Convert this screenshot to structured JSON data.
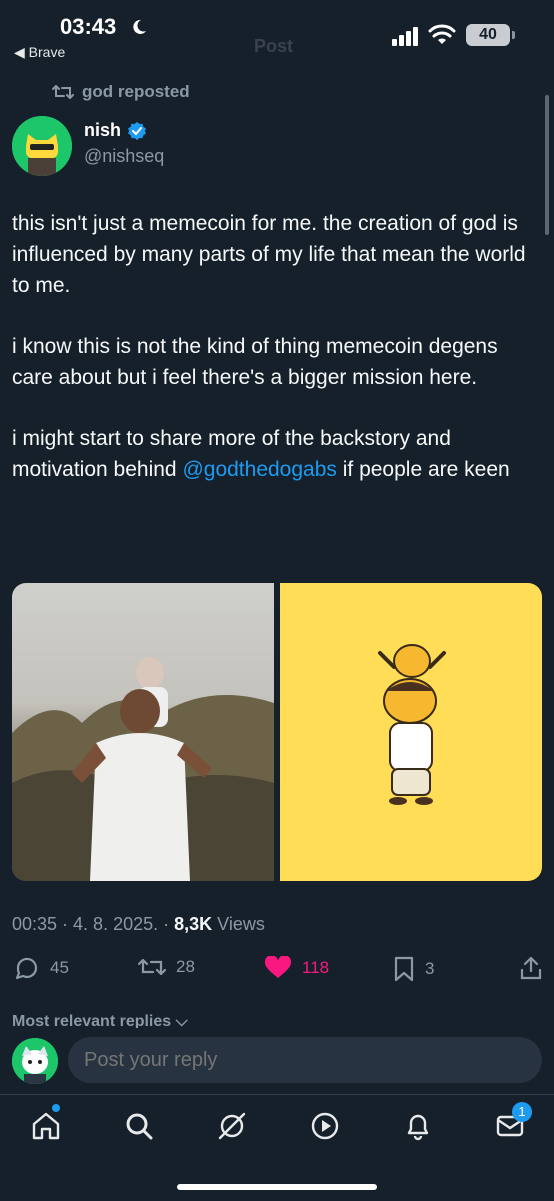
{
  "status_bar": {
    "time": "03:43",
    "back_label": "◀ Brave",
    "battery": "40",
    "ghost_title": "Post"
  },
  "repost": {
    "label": "god reposted"
  },
  "author": {
    "name": "nish",
    "handle": "@nishseq"
  },
  "tweet": {
    "p1": "this isn't just a memecoin for me. the creation of god is influenced by many parts of my life that mean the world to me.",
    "p2": "i know this is not the kind of thing memecoin degens care about but i feel there's a bigger mission here.",
    "p3_before": "i might start to share more of the backstory and motivation behind ",
    "p3_mention": "@godthedogabs",
    "p3_after": " if people are keen"
  },
  "meta": {
    "time": "00:35 · 4. 8. 2025. · ",
    "views_count": "8,3K",
    "views_label": " Views"
  },
  "actions": {
    "replies": "45",
    "reposts": "28",
    "likes": "118",
    "bookmarks": "3"
  },
  "replies_header": "Most relevant replies ⌵",
  "reply_placeholder": "Post your reply",
  "notifications_badge": "1",
  "colors": {
    "background": "#15202b",
    "accent": "#1d9bf0",
    "like": "#f91880",
    "muted": "#8b98a5"
  }
}
